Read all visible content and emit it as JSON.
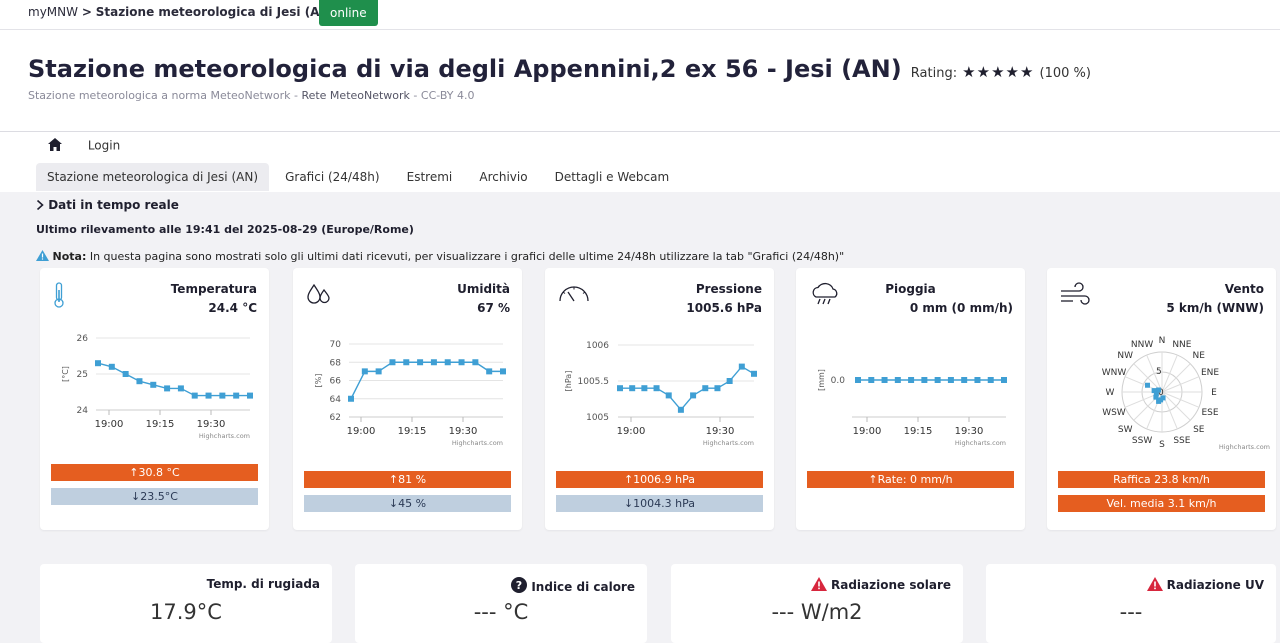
{
  "breadcrumb": {
    "root": "myMNW",
    "separator1": ">",
    "station": "Stazione meteorologica di Jesi (AN)",
    "separator2": "/",
    "status": "online"
  },
  "header": {
    "title": "Stazione meteorologica di via degli Appennini,2 ex 56 - Jesi (AN)",
    "rating_label": "Rating:",
    "stars": "★★★★★",
    "rating_value": "(100 %)",
    "subtitle_a": "Stazione meteorologica a norma MeteoNetwork - ",
    "subtitle_b": "Rete MeteoNetwork",
    "subtitle_c": " - CC-BY 4.0"
  },
  "nav": {
    "login": "Login"
  },
  "tabs": [
    {
      "label": "Stazione meteorologica di Jesi (AN)"
    },
    {
      "label": "Grafici (24/48h)"
    },
    {
      "label": "Estremi"
    },
    {
      "label": "Archivio"
    },
    {
      "label": "Dettagli e Webcam"
    }
  ],
  "section": {
    "title": "Dati in tempo reale"
  },
  "last_update": "Ultimo rilevamento alle 19:41 del 2025-08-29 (Europe/Rome)",
  "note": {
    "label": "Nota:",
    "text": " In questa pagina sono mostrati solo gli ultimi dati ricevuti, per visualizzare i grafici delle ultime 24/48h utilizzare la tab \"Grafici (24/48h)\""
  },
  "colors": {
    "max_bar": "#e55e20",
    "min_bar": "#bfcfdf",
    "series": "#3f9fd4",
    "online": "#1f8f4c"
  },
  "cards": {
    "temperature": {
      "icon": "thermometer-icon",
      "name": "Temperatura",
      "value": "24.4 °C",
      "max": "↑30.8 °C",
      "min": "↓23.5°C"
    },
    "humidity": {
      "icon": "humidity-icon",
      "name": "Umidità",
      "value": "67 %",
      "max": "↑81 %",
      "min": "↓45 %"
    },
    "pressure": {
      "icon": "gauge-icon",
      "name": "Pressione",
      "value": "1005.6 hPa",
      "max": "↑1006.9 hPa",
      "min": "↓1004.3 hPa"
    },
    "rain": {
      "icon": "rain-cloud-icon",
      "name": "Pioggia",
      "value": "0 mm (0 mm/h)",
      "rate": "↑Rate: 0 mm/h"
    },
    "wind": {
      "icon": "wind-icon",
      "name": "Vento",
      "value": "5 km/h (WNW)",
      "gust": "Raffica 23.8 km/h",
      "avg": "Vel. media 3.1 km/h"
    }
  },
  "chart_data": [
    {
      "type": "line",
      "name": "temperature",
      "ylabel": "[°C]",
      "yticks": [
        "26",
        "25",
        "24"
      ],
      "ylim": [
        24,
        26
      ],
      "x_ticks": [
        "19:00",
        "19:15",
        "19:30"
      ],
      "credit": "Highcharts.com",
      "x": [
        0,
        1,
        2,
        3,
        4,
        5,
        6,
        7,
        8,
        9,
        10,
        11
      ],
      "y": [
        25.3,
        25.2,
        25.0,
        24.8,
        24.7,
        24.6,
        24.6,
        24.4,
        24.4,
        24.4,
        24.4,
        24.4
      ]
    },
    {
      "type": "line",
      "name": "humidity",
      "ylabel": "[%]",
      "yticks": [
        "70",
        "68",
        "66",
        "64",
        "62"
      ],
      "ylim": [
        62,
        70
      ],
      "x_ticks": [
        "19:00",
        "19:15",
        "19:30"
      ],
      "credit": "Highcharts.com",
      "x": [
        0,
        1,
        2,
        3,
        4,
        5,
        6,
        7,
        8,
        9,
        10,
        11
      ],
      "y": [
        64,
        67,
        67,
        68,
        68,
        68,
        68,
        68,
        68,
        68,
        67,
        67
      ]
    },
    {
      "type": "line",
      "name": "pressure",
      "ylabel": "[hPa]",
      "yticks": [
        "1006",
        "1005.5",
        "1005"
      ],
      "ylim": [
        1005,
        1006
      ],
      "x_ticks": [
        "19:00",
        "19:30"
      ],
      "credit": "Highcharts.com",
      "x": [
        0,
        1,
        2,
        3,
        4,
        5,
        6,
        7,
        8,
        9,
        10,
        11,
        12,
        13
      ],
      "y": [
        1005.4,
        1005.4,
        1005.4,
        1005.4,
        1005.3,
        1005.1,
        1005.3,
        1005.4,
        1005.4,
        1005.5,
        1005.7,
        1005.6
      ]
    },
    {
      "type": "line",
      "name": "rain",
      "ylabel": "[mm]",
      "yticks": [
        "0.0"
      ],
      "ylim": [
        -0.5,
        0.5
      ],
      "x_ticks": [
        "19:00",
        "19:15",
        "19:30"
      ],
      "credit": "Highcharts.com",
      "x": [
        0,
        1,
        2,
        3,
        4,
        5,
        6,
        7,
        8,
        9,
        10,
        11
      ],
      "y": [
        0,
        0,
        0,
        0,
        0,
        0,
        0,
        0,
        0,
        0,
        0,
        0
      ]
    },
    {
      "type": "scatter",
      "name": "wind-rose",
      "directions": [
        "N",
        "NNE",
        "NE",
        "ENE",
        "E",
        "ESE",
        "SE",
        "SSE",
        "S",
        "SSW",
        "SW",
        "WSW",
        "W",
        "WNW",
        "NW",
        "NNW"
      ],
      "radial_ticks": [
        "5",
        "0"
      ],
      "credit": "Highcharts.com",
      "points": [
        {
          "dir_deg": 295,
          "speed": 4
        },
        {
          "dir_deg": 280,
          "speed": 2
        },
        {
          "dir_deg": 250,
          "speed": 1.5
        },
        {
          "dir_deg": 230,
          "speed": 2
        },
        {
          "dir_deg": 200,
          "speed": 2.5
        },
        {
          "dir_deg": 190,
          "speed": 2
        },
        {
          "dir_deg": 170,
          "speed": 1.5
        },
        {
          "dir_deg": 300,
          "speed": 1
        }
      ]
    }
  ],
  "bottom": {
    "dew": {
      "label": "Temp. di rugiada",
      "value": "17.9°C"
    },
    "heat": {
      "label": "Indice di calore",
      "value": "--- °C"
    },
    "solar": {
      "label": "Radiazione solare",
      "value": "--- W/m2"
    },
    "uv": {
      "label": "Radiazione UV",
      "value": "---"
    }
  }
}
